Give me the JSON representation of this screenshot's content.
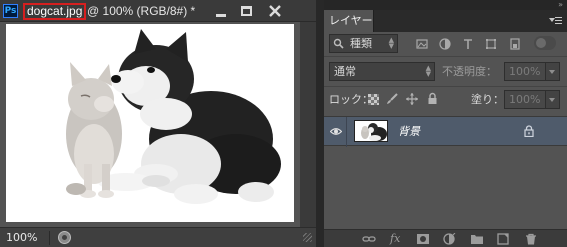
{
  "document": {
    "filename": "dogcat.jpg",
    "title_suffix": "@ 100% (RGB/8#) *",
    "zoom": "100%",
    "app_logo": "Ps"
  },
  "layers_panel": {
    "tab_label": "レイヤー",
    "filter_kind": "種類",
    "blend_mode": "通常",
    "opacity_label": "不透明度：",
    "opacity_value": "100%",
    "lock_label": "ロック：",
    "fill_label": "塗り：",
    "fill_value": "100%",
    "layers": [
      {
        "name": "背景",
        "visible": true,
        "locked": true
      }
    ],
    "footer_icons": [
      "link-icon",
      "fx-icon",
      "mask-icon",
      "adjustment-icon",
      "folder-icon",
      "new-layer-icon",
      "trash-icon"
    ]
  },
  "colors": {
    "highlight_box": "#d61f1f",
    "selected_layer": "#4f5b6b",
    "panel_bg": "#535353"
  }
}
